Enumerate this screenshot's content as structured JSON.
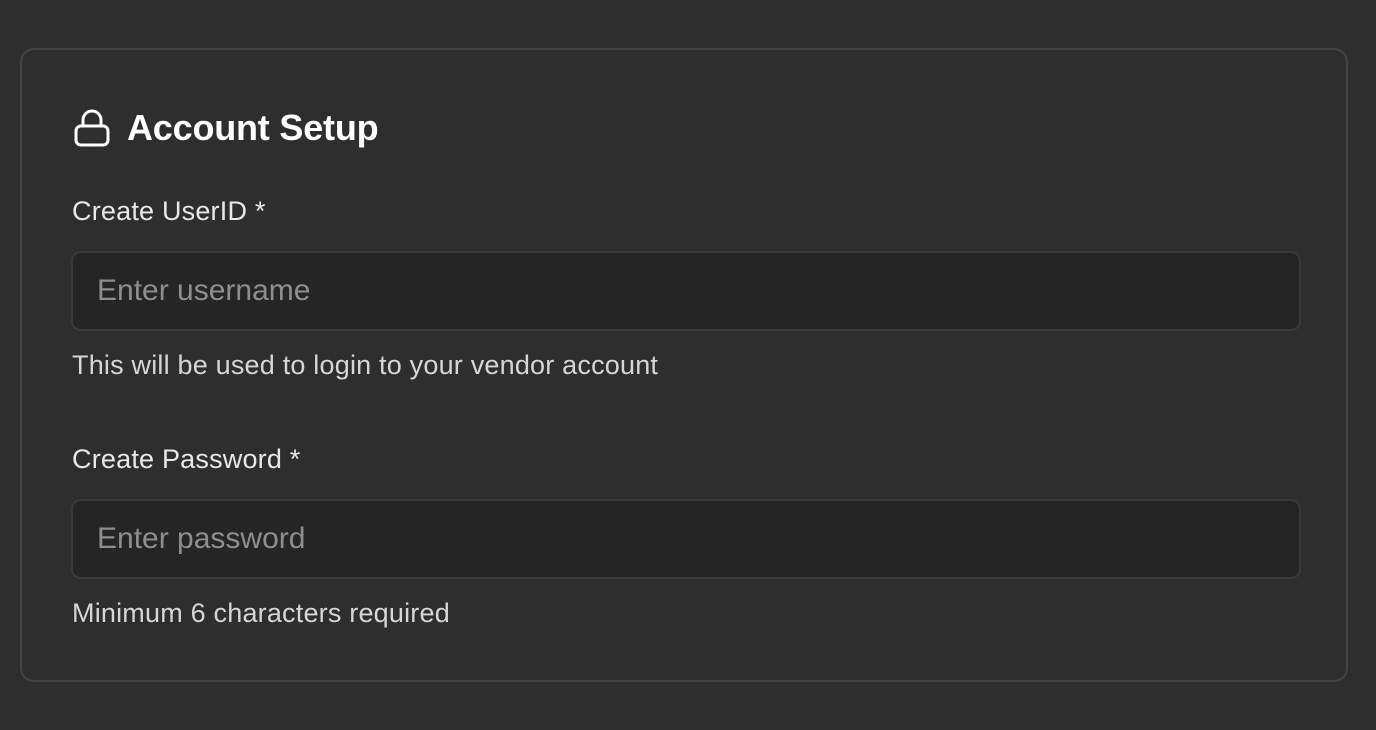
{
  "section": {
    "title": "Account Setup",
    "icon": "lock-icon"
  },
  "userid": {
    "label": "Create UserID *",
    "placeholder": "Enter username",
    "value": "",
    "help": "This will be used to login to your vendor account"
  },
  "password": {
    "label": "Create Password *",
    "placeholder": "Enter password",
    "value": "",
    "help": "Minimum 6 characters required"
  },
  "colors": {
    "background": "#2e2e2e",
    "card_border": "#434343",
    "input_background": "#252525",
    "title": "#ffffff",
    "placeholder": "#8e8e8e"
  }
}
